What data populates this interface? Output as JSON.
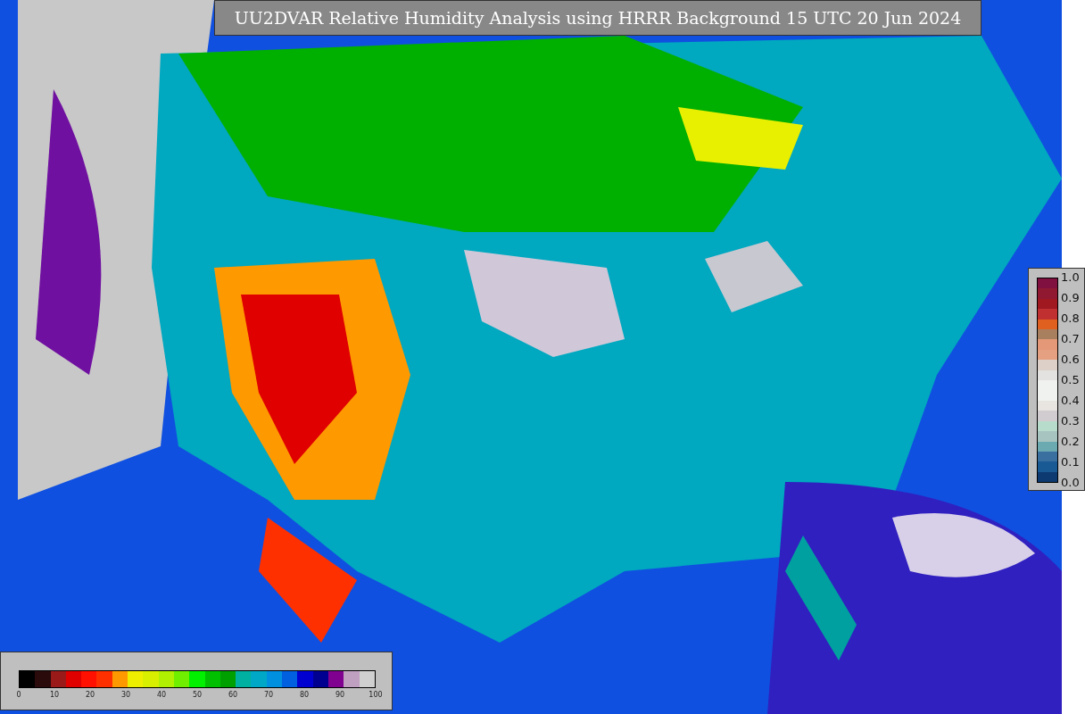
{
  "title": "UU2DVAR Relative Humidity Analysis using HRRR Background 15 UTC 20 Jun 2024",
  "humidity_colorbar": {
    "ticks": [
      "0",
      "10",
      "20",
      "30",
      "40",
      "50",
      "60",
      "70",
      "80",
      "90",
      "100"
    ]
  },
  "observation_colorbar": {
    "ticks": [
      "1.0",
      "0.9",
      "0.8",
      "0.7",
      "0.6",
      "0.5",
      "0.4",
      "0.3",
      "0.2",
      "0.1",
      "0.0"
    ]
  }
}
